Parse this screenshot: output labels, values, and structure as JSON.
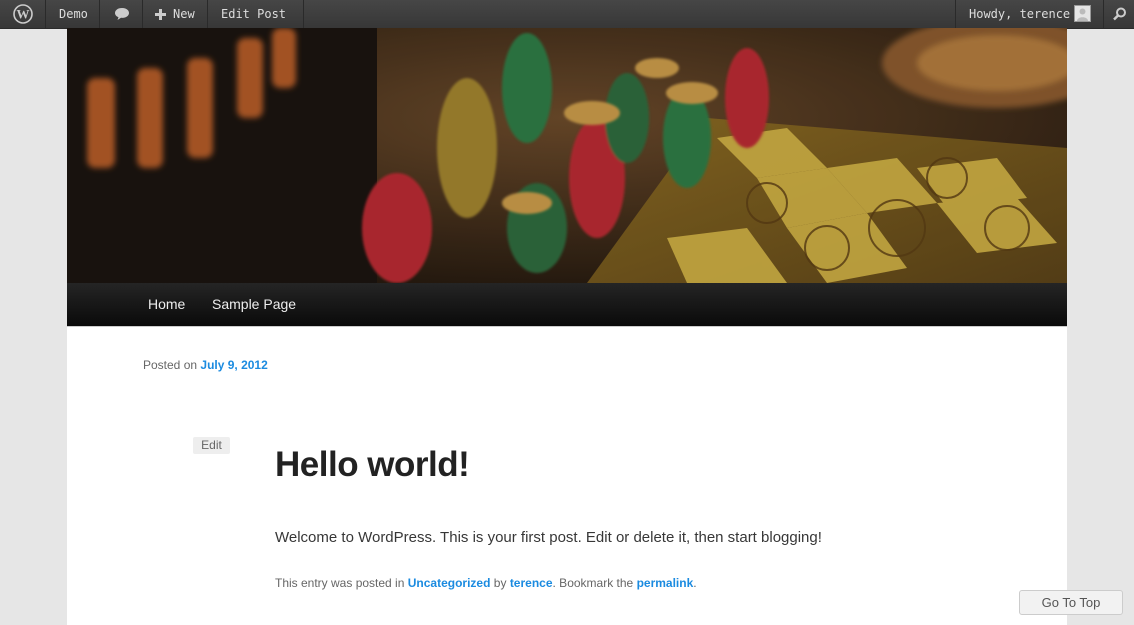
{
  "admin_bar": {
    "site_name": "Demo",
    "new_label": "New",
    "edit_post_label": "Edit Post",
    "howdy_label": "Howdy, terence"
  },
  "nav": {
    "items": [
      "Home",
      "Sample Page"
    ]
  },
  "post": {
    "posted_on_prefix": "Posted on",
    "date": "July 9, 2012",
    "edit_label": "Edit",
    "title": "Hello world!",
    "content": "Welcome to WordPress. This is your first post. Edit or delete it, then start blogging!",
    "meta_prefix": "This entry was posted in",
    "category": "Uncategorized",
    "meta_by": "by",
    "author": "terence",
    "meta_bookmark": ". Bookmark the",
    "permalink_label": "permalink",
    "meta_suffix": "."
  },
  "go_to_top_label": "Go To Top",
  "colors": {
    "link": "#1b8be0",
    "admin_bar": "#464646",
    "nav": "#181818",
    "background": "#e6e6e6"
  }
}
